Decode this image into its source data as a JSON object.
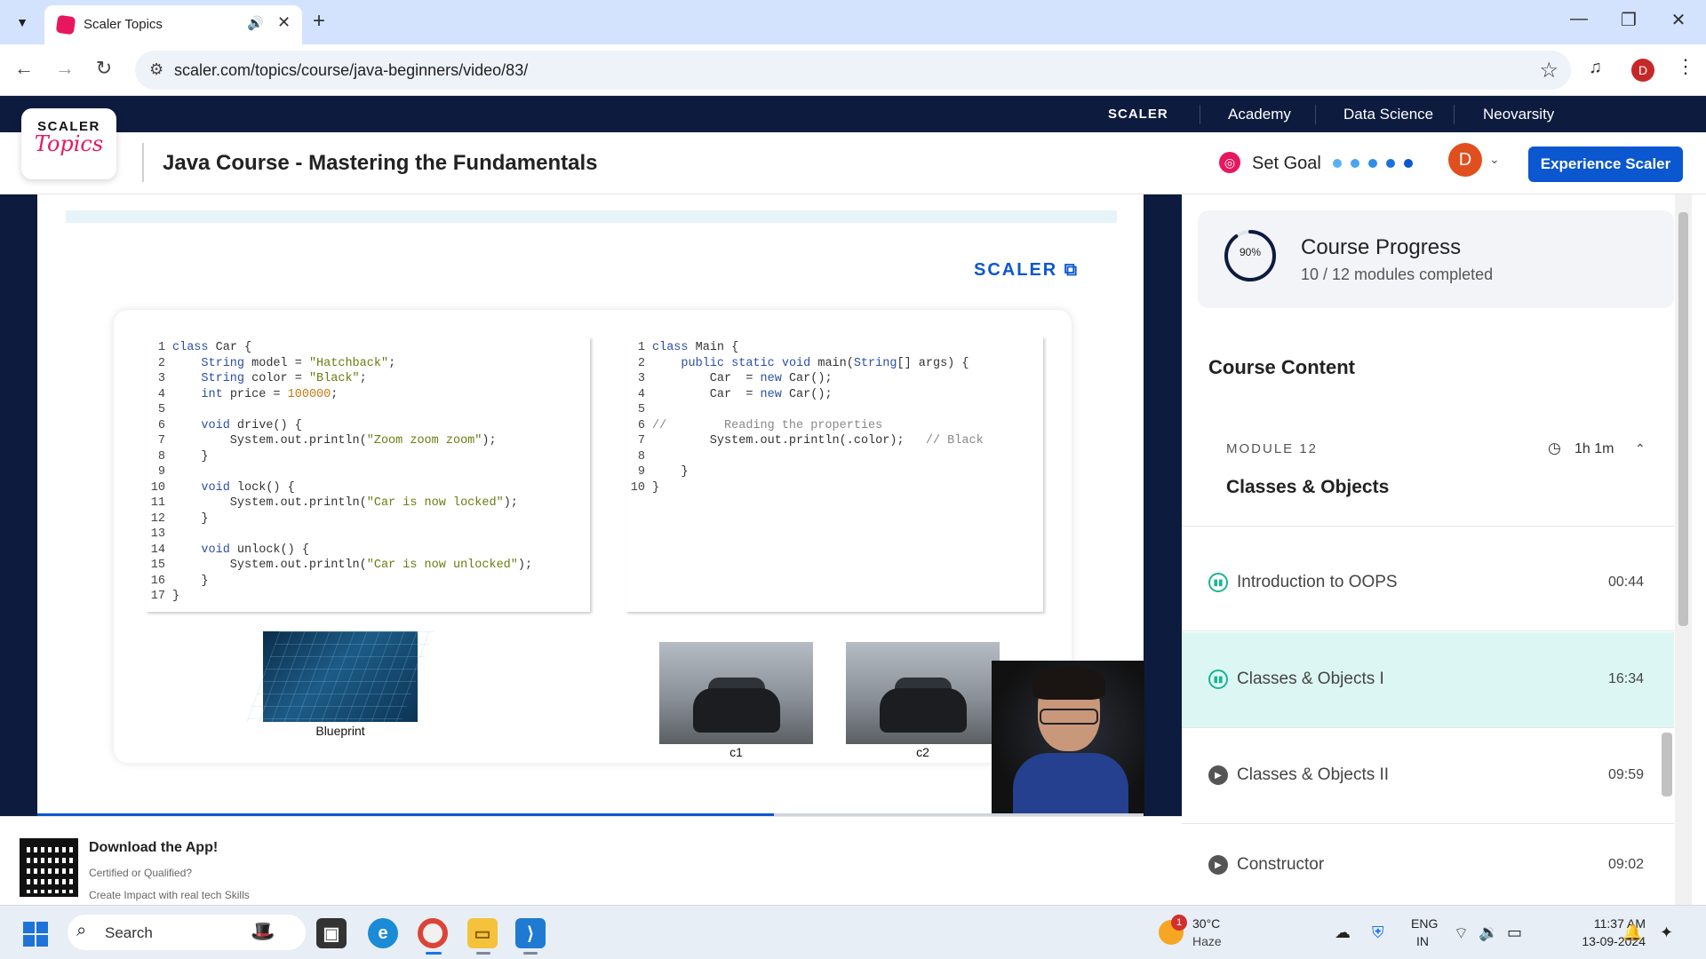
{
  "browser": {
    "tab_title": "Scaler Topics",
    "url": "scaler.com/topics/course/java-beginners/video/83/",
    "profile_initial": "D"
  },
  "site_strip": {
    "brand": "SCALER",
    "links": [
      "Academy",
      "Data Science",
      "Neovarsity"
    ]
  },
  "header": {
    "logo_top": "SCALER",
    "logo_bottom": "Topics",
    "course_title": "Java Course - Mastering the Fundamentals",
    "set_goal": "Set Goal",
    "goal_dot_colors": [
      "#5ab0f2",
      "#4aa3ee",
      "#2f8ee6",
      "#1a73d9",
      "#0a57d0"
    ],
    "user_initial": "D",
    "cta": "Experience Scaler"
  },
  "slide": {
    "brand": "SCALER",
    "code_left": [
      "class Car {",
      "    String model = \"Hatchback\";",
      "    String color = \"Black\";",
      "    int price = 100000;",
      "",
      "    void drive() {",
      "        System.out.println(\"Zoom zoom zoom\");",
      "    }",
      "",
      "    void lock() {",
      "        System.out.println(\"Car is now locked\");",
      "    }",
      "",
      "    void unlock() {",
      "        System.out.println(\"Car is now unlocked\");",
      "    }",
      "}"
    ],
    "code_right": [
      "class Main {",
      "    public static void main(String[] args) {",
      "        Car c1 = new Car();",
      "        Car c2 = new Car();",
      "",
      "//        Reading the properties",
      "        System.out.println(c1.color);   // Black",
      "",
      "    }",
      "}"
    ],
    "captions": {
      "blueprint": "Blueprint",
      "car1": "c1",
      "car2": "c2"
    },
    "video_progress_fraction": 0.666
  },
  "sidebar": {
    "progress_percent": 90,
    "progress_label": "90%",
    "progress_title": "Course Progress",
    "progress_sub": "10 / 12 modules completed",
    "content_heading": "Course Content",
    "module": {
      "label": "MODULE 12",
      "title": "Classes & Objects",
      "duration": "1h 1m"
    },
    "lessons": [
      {
        "title": "Introduction to OOPS",
        "time": "00:44",
        "state": "done"
      },
      {
        "title": "Classes & Objects I",
        "time": "16:34",
        "state": "active"
      },
      {
        "title": "Classes & Objects II",
        "time": "09:59",
        "state": "pending"
      },
      {
        "title": "Constructor",
        "time": "09:02",
        "state": "pending"
      }
    ]
  },
  "banner": {
    "title": "Download the App!",
    "sub1": "Certified or Qualified?",
    "sub2": "Create Impact with real tech Skills"
  },
  "taskbar": {
    "search_label": "Search",
    "weather_temp": "30°C",
    "weather_cond": "Haze",
    "weather_badge": "1",
    "lang_1": "ENG",
    "lang_2": "IN",
    "time": "11:37 AM",
    "date": "13-09-2024"
  }
}
